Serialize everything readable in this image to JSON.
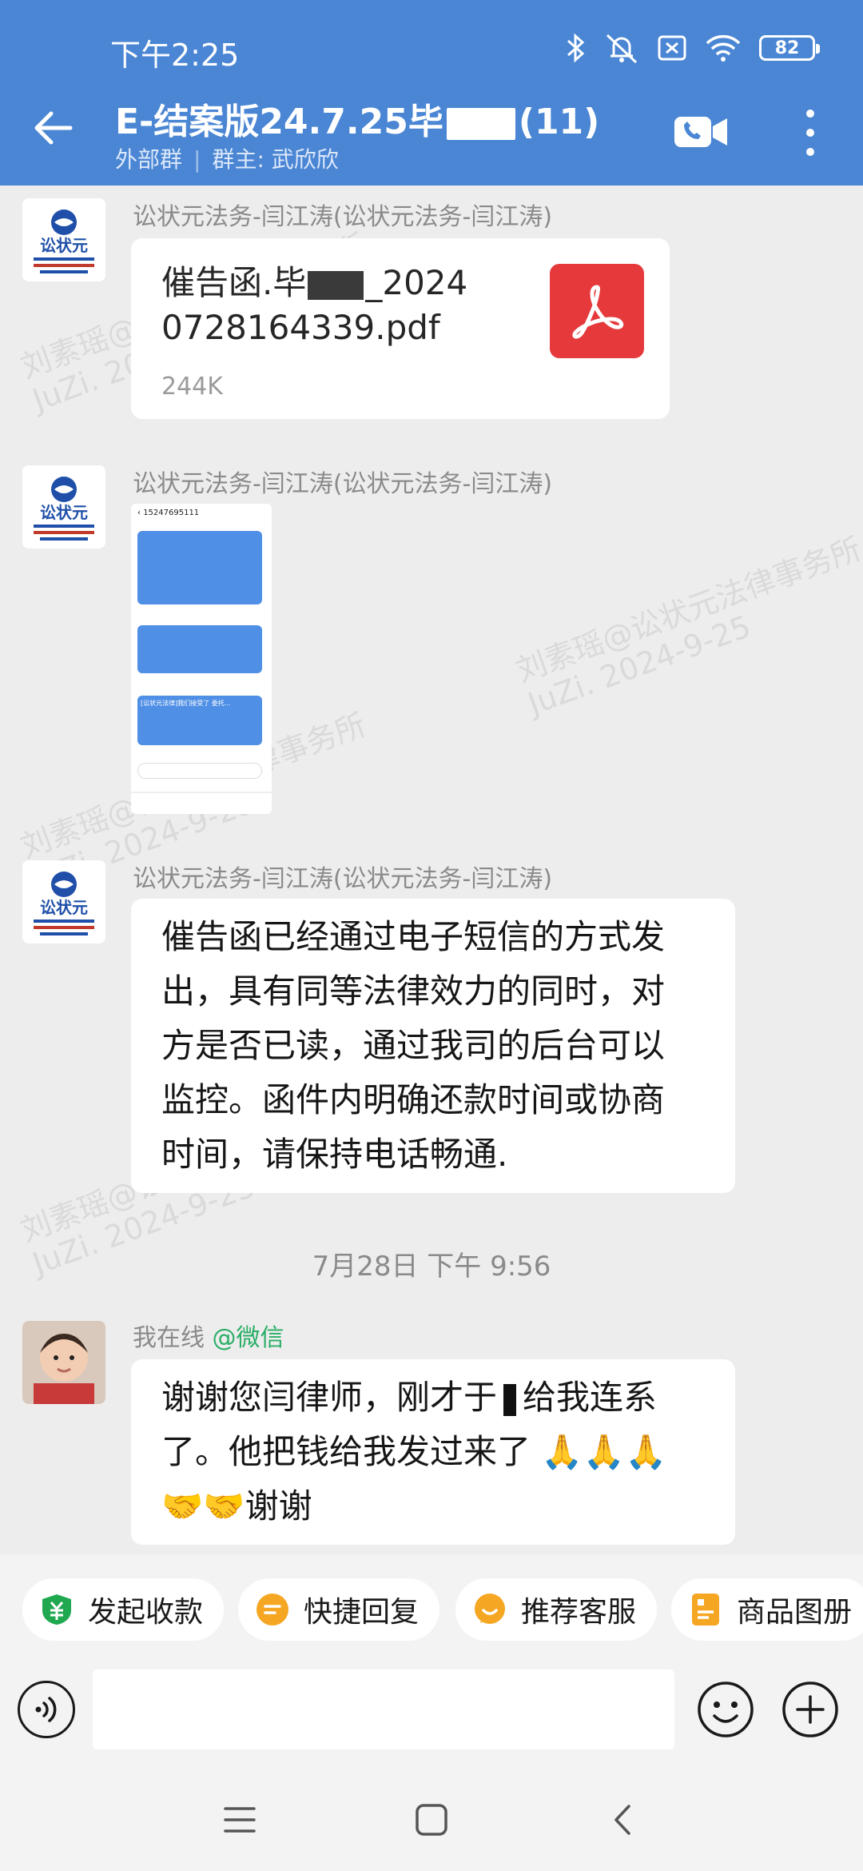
{
  "status_bar": {
    "time": "下午2:25",
    "battery": "82"
  },
  "chat": {
    "title_prefix": "E-结案版24.7.25毕",
    "title_suffix": "(11)",
    "type": "外部群",
    "owner": "群主: 武欣欣"
  },
  "messages": [
    {
      "sender": "讼状元法务-闫江涛(讼状元法务-闫江涛)",
      "file_name_1": "催告函.毕",
      "file_name_2": "_2024",
      "file_name_3": "0728164339.pdf",
      "file_size": "244K"
    },
    {
      "sender": "讼状元法务-闫江涛(讼状元法务-闫江涛)",
      "sms_screenshot": {
        "number": "15247695111",
        "msg1": "[讼状元法律]我们接受了 委托..."
      }
    },
    {
      "sender": "讼状元法务-闫江涛(讼状元法务-闫江涛)",
      "text": [
        "催告函已经通过电子短信的方式发",
        "出，具有同等法律效力的同时，对",
        "方是否已读，通过我司的后台可以",
        "监控。函件内明确还款时间或协商",
        "时间，请保持电话畅通."
      ]
    },
    {
      "sender_name": "我在线",
      "sender_tag": "@微信",
      "text_1": "谢谢您闫律师，刚才于",
      "text_2": "给我连系",
      "text_3": "了。他把钱给我发过来了",
      "text_4": "谢谢"
    }
  ],
  "time_separator": "7月28日  下午 9:56",
  "logo": {
    "name": "讼状元"
  },
  "watermark": {
    "line1": "刘素瑶@讼状元法律事务所",
    "line2": "JuZi. 2024-9-25"
  },
  "quick_actions": [
    "发起收款",
    "快捷回复",
    "推荐客服",
    "商品图册"
  ],
  "colors": {
    "header": "#4a86d4",
    "pdf": "#e5393b",
    "wechat_tag": "#2aae67",
    "chip_green": "#1fa84f",
    "chip_orange": "#f5a623"
  }
}
